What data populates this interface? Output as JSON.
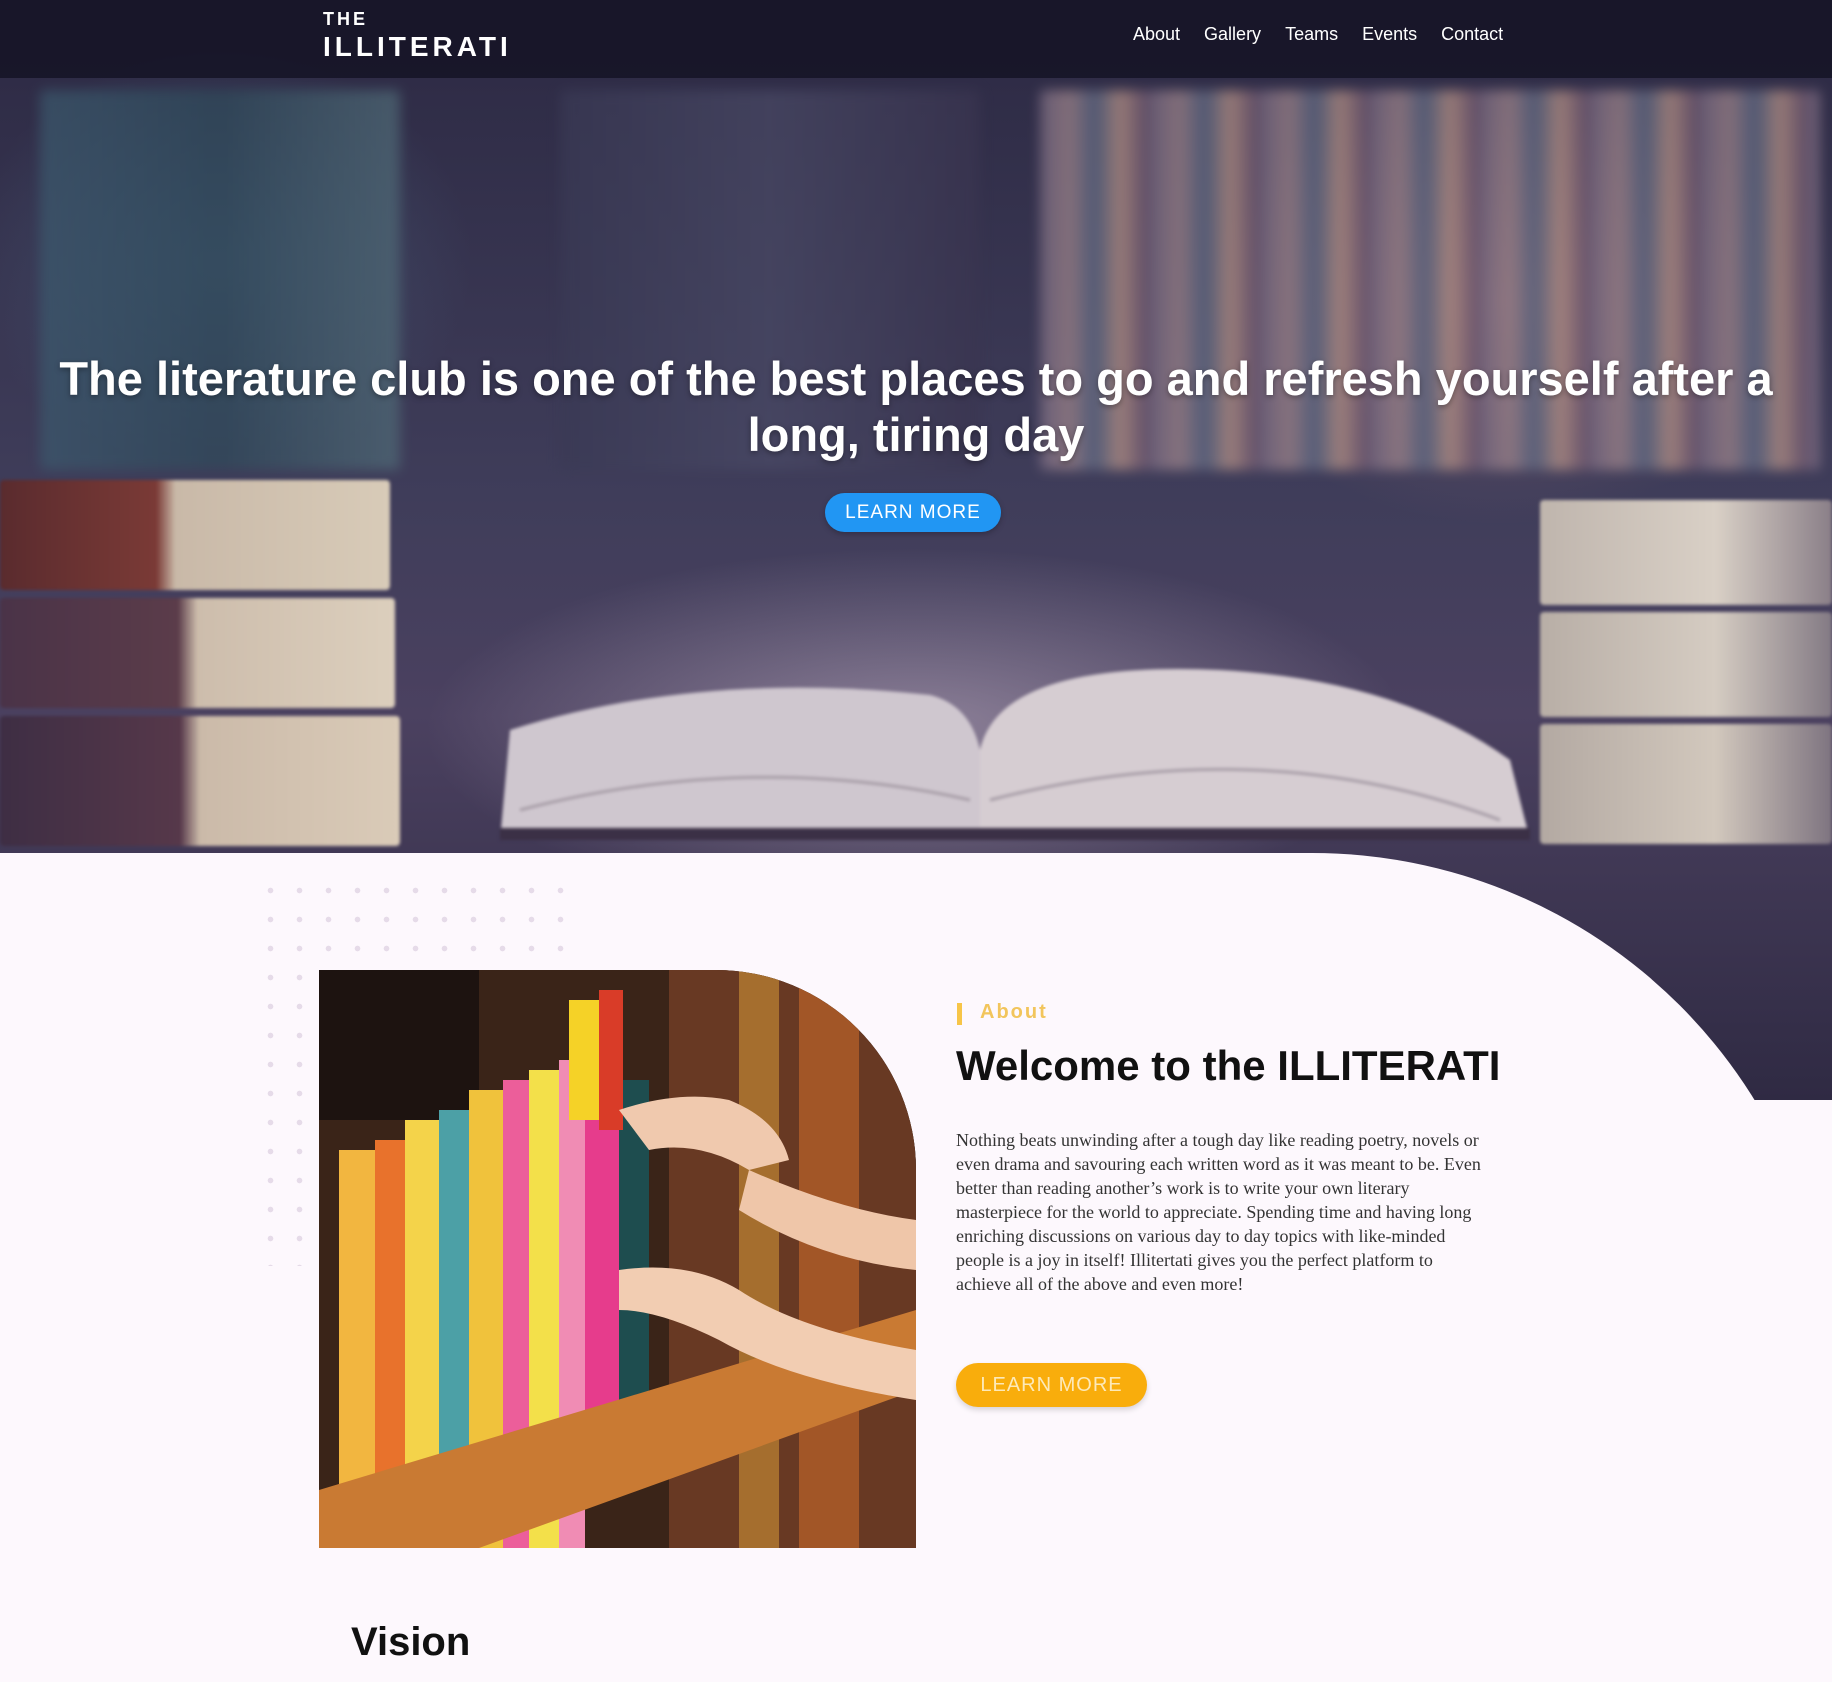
{
  "nav": {
    "logo_small": "THE",
    "logo_big": "ILLITERATI",
    "links": [
      "About",
      "Gallery",
      "Teams",
      "Events",
      "Contact"
    ]
  },
  "hero": {
    "title": "The literature club is one of the best places to go and refresh yourself after a long, tiring day",
    "button_label": "LEARN MORE"
  },
  "about": {
    "label": "About",
    "heading": "Welcome to the ILLITERATI",
    "body": "Nothing beats unwinding after a tough day like reading poetry, novels or even drama and savouring each written word as it was meant to be. Even better than reading another’s work is to write your own literary masterpiece for the world to appreciate. Spending time and having long enriching discussions on various day to day topics with like-minded people is a joy in itself! Illitertati gives you the perfect platform to achieve all of the above and even more!",
    "button_label": "LEARN MORE"
  },
  "vision": {
    "heading": "Vision"
  },
  "colors": {
    "hero_button": "#2196f3",
    "about_button": "#f9ad0c",
    "about_label": "#f2c55c",
    "nav_background": "#141223"
  }
}
